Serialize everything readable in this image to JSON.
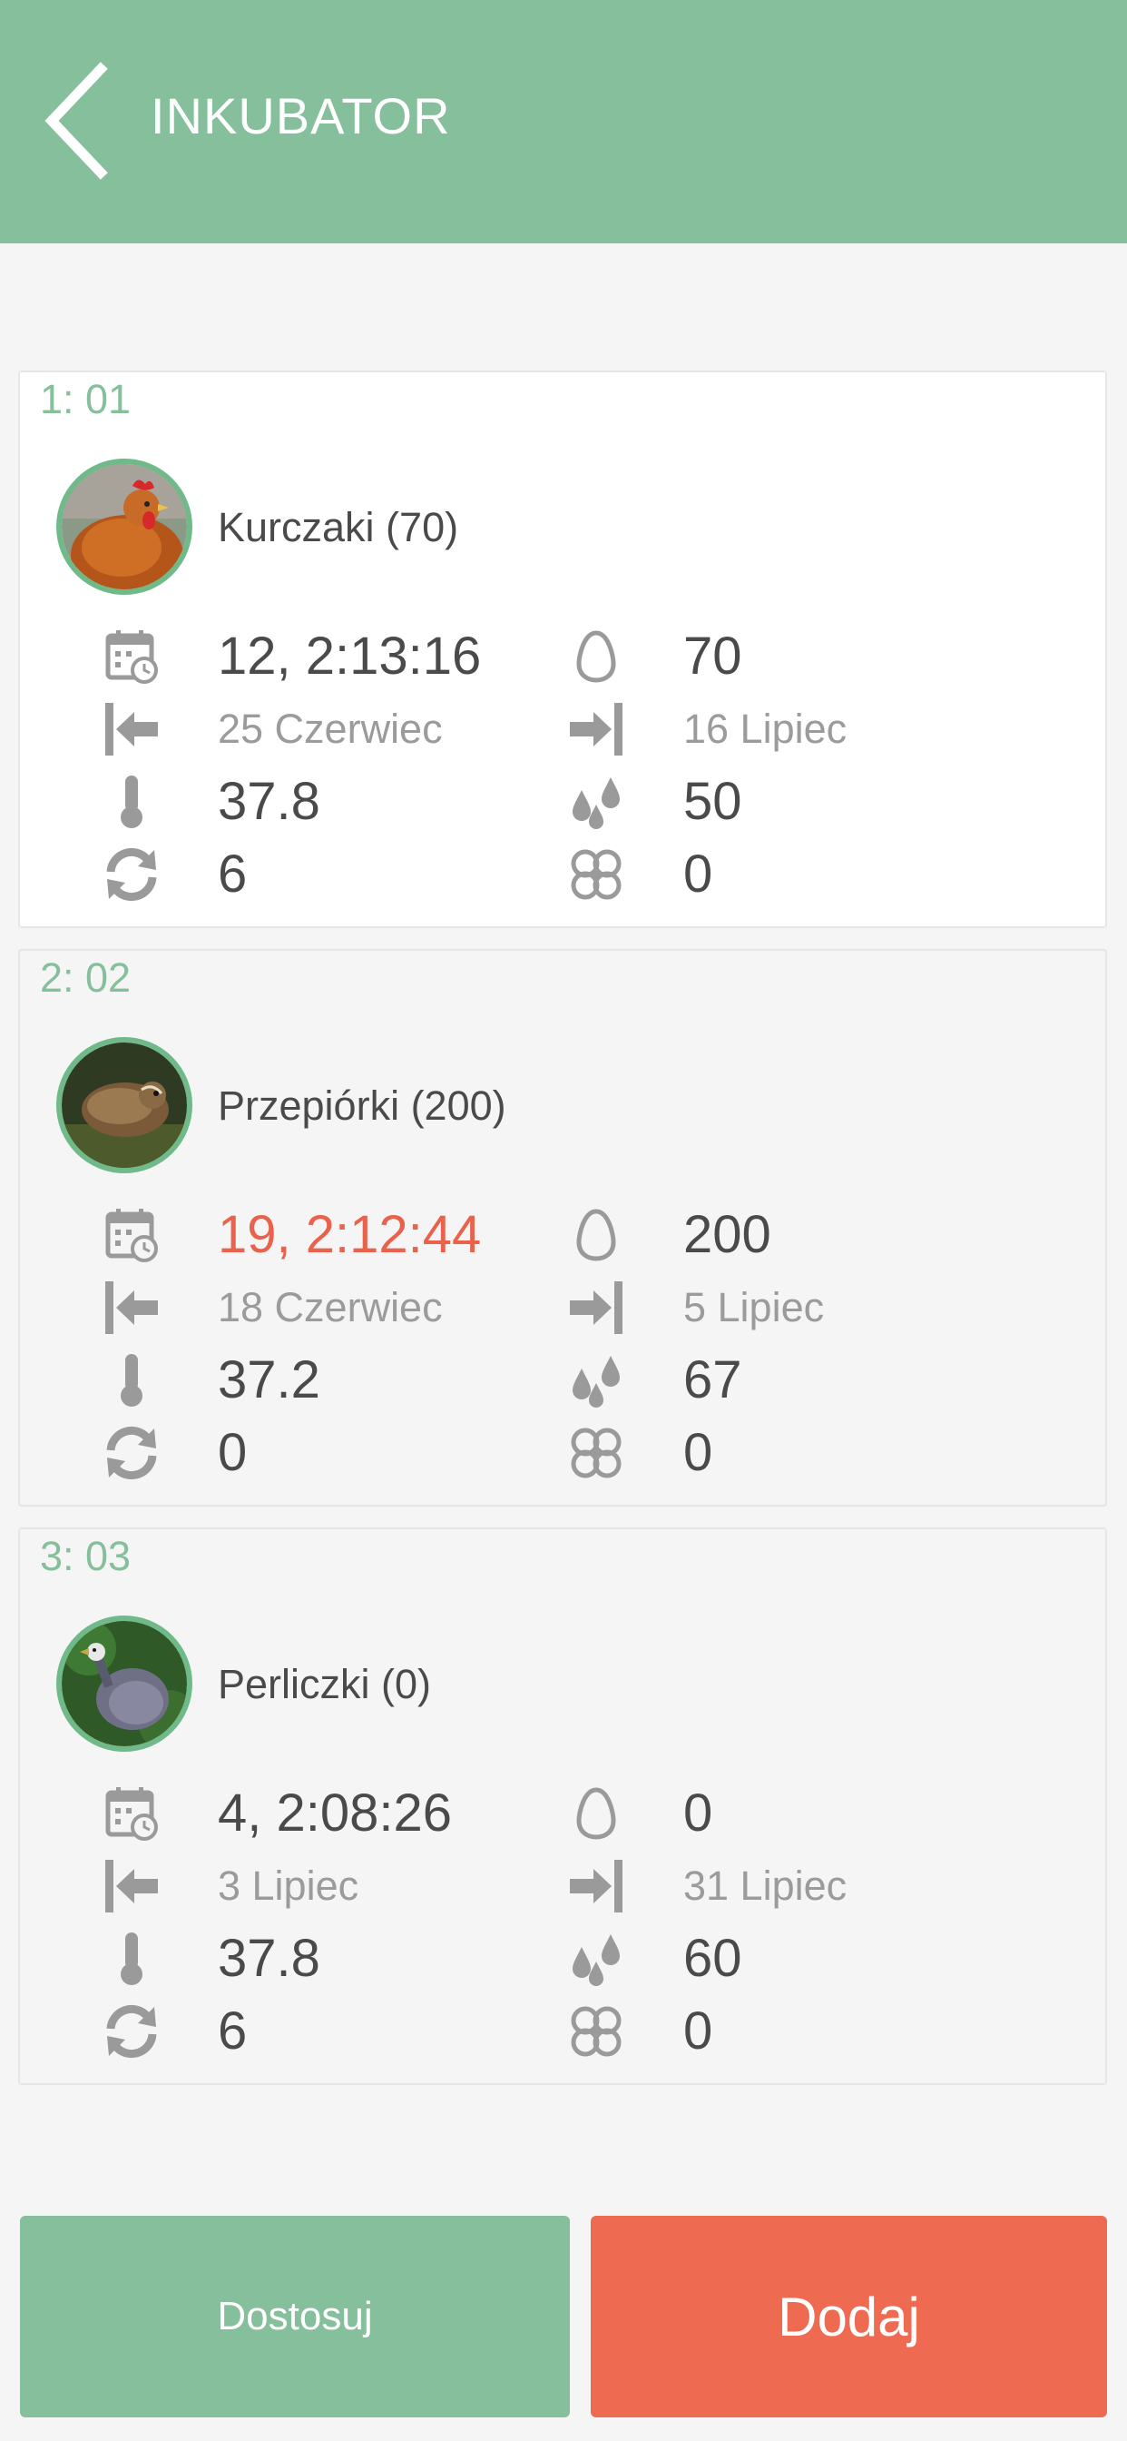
{
  "colors": {
    "header": "#85bf9b",
    "accent": "#85bf9b",
    "alert": "#e8624c",
    "add_button": "#ee6b52",
    "page_bg": "#f5f5f5"
  },
  "header": {
    "back_icon": "chevron-left-icon",
    "title": "INKUBATOR"
  },
  "incubators": [
    {
      "id": "1: 01",
      "species": "Kurczaki (70)",
      "avatar": "chicken-photo",
      "time": "12, 2:13:16",
      "eggs": "70",
      "start_date": "25 Czerwiec",
      "end_date": "16 Lipiec",
      "temperature": "37.8",
      "humidity": "50",
      "rotation": "6",
      "fan": "0"
    },
    {
      "id": "2: 02",
      "species": "Przepiórki (200)",
      "avatar": "quail-photo",
      "time": "19, 2:12:44",
      "eggs": "200",
      "start_date": "18 Czerwiec",
      "end_date": "5 Lipiec",
      "temperature": "37.2",
      "humidity": "67",
      "rotation": "0",
      "fan": "0"
    },
    {
      "id": "3: 03",
      "species": "Perliczki (0)",
      "avatar": "guinea-fowl-photo",
      "time": "4, 2:08:26",
      "eggs": "0",
      "start_date": "3 Lipiec",
      "end_date": "31 Lipiec",
      "temperature": "37.8",
      "humidity": "60",
      "rotation": "6",
      "fan": "0"
    }
  ],
  "buttons": {
    "adjust": "Dostosuj",
    "add": "Dodaj"
  }
}
